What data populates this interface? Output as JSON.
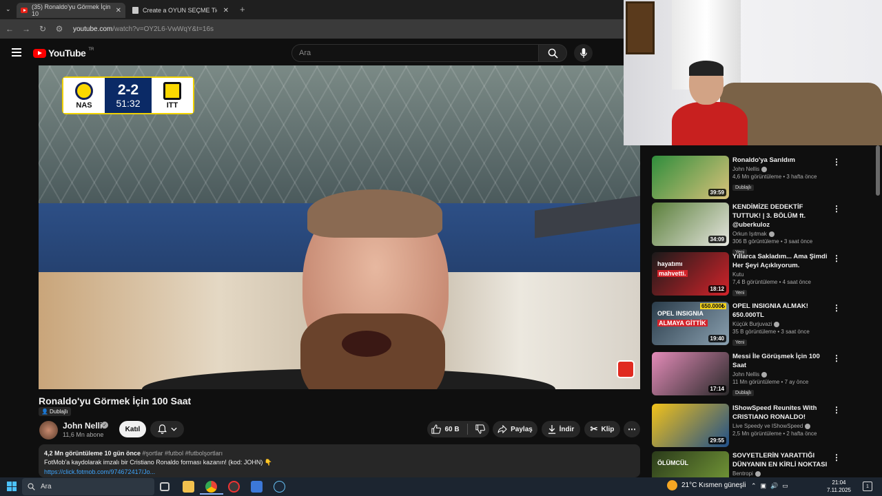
{
  "browser": {
    "tabs": [
      {
        "title": "(35) Ronaldo'yu Görmek İçin 10",
        "active": true
      },
      {
        "title": "Create a OYUN SEÇME Tier List",
        "active": false
      }
    ],
    "url_host": "youtube.com",
    "url_rest": "/watch?v=OY2L6-VwWqY&t=16s"
  },
  "youtube": {
    "logo_text": "YouTube",
    "region": "TR",
    "search_placeholder": "Ara"
  },
  "video": {
    "scoreboard": {
      "home": "NAS",
      "away": "ITT",
      "score": "2-2",
      "clock": "51:32"
    },
    "title": "Ronaldo'yu Görmek İçin 100 Saat",
    "dub_label": "Dublajlı"
  },
  "channel": {
    "name": "John Nellis",
    "subs": "11,6 Mn abone",
    "join_label": "Katıl"
  },
  "actions": {
    "likes": "60 B",
    "share": "Paylaş",
    "download": "İndir",
    "clip": "Klip"
  },
  "description": {
    "meta": "4,2 Mn görüntüleme  10 gün önce",
    "tags": "#şortlar #futbol #futbolşortları",
    "line1": "FotMob'a kaydolarak imzalı bir Cristiano Ronaldo forması kazanın! (kod: JOHN) 👇",
    "link": "https://click.fotmob.com/974672417/Jo..."
  },
  "sidebar": [
    {
      "title": "Ronaldo'ya Sarıldım",
      "channel": "John Nellis",
      "verified": true,
      "meta": "4,6 Mn görüntüleme • 3 hafta önce",
      "badge": "Dublajlı",
      "duration": "39:59",
      "c1": "#2f8d3c",
      "c2": "#d9c27a"
    },
    {
      "title": "KENDİMİZE DEDEKTİF TUTTUK! | 3. BÖLÜM ft. @uberkuloz",
      "channel": "Orkun Işıtmak",
      "verified": true,
      "meta": "306 B görüntüleme • 3 saat önce",
      "badge": "Yeni",
      "duration": "34:09",
      "c1": "#5a7f3a",
      "c2": "#e6e6e0"
    },
    {
      "title": "Yıllarca Sakladım... Ama Şimdi Her Şeyi Açıklıyorum.",
      "channel": "Kutu",
      "verified": false,
      "meta": "7,4 B görüntüleme • 4 saat önce",
      "badge": "Yeni",
      "duration": "18:12",
      "c1": "#1a1a1a",
      "c2": "#d3232a",
      "thumb_text1": "hayatımı",
      "thumb_text2": "mahvetti."
    },
    {
      "title": "OPEL INSIGNIA ALMAK! 650.000TL",
      "channel": "Küçük Burjuvazi",
      "verified": true,
      "meta": "35 B görüntüleme • 3 saat önce",
      "badge": "Yeni",
      "duration": "19:40",
      "c1": "#2a3c4a",
      "c2": "#8aa0b0",
      "thumb_text1": "OPEL INSIGNIA",
      "thumb_text2": "ALMAYA GİTTİK",
      "thumb_price": "650.000₺"
    },
    {
      "title": "Messi İle Görüşmek İçin 100 Saat",
      "channel": "John Nellis",
      "verified": true,
      "meta": "11 Mn görüntüleme • 7 ay önce",
      "badge": "Dublajlı",
      "duration": "17:14",
      "c1": "#e38bb8",
      "c2": "#2a2a2a"
    },
    {
      "title": "IShowSpeed Reunites With CRISTIANO RONALDO!",
      "channel": "Live Speedy ve IShowSpeed",
      "verified": true,
      "meta": "2,5 Mn görüntüleme • 2 hafta önce",
      "badge": "",
      "duration": "29:55",
      "c1": "#f2c21a",
      "c2": "#1f4f8a"
    },
    {
      "title": "SOVYETLERİN YARATTIĞI DÜNYANIN EN KİRLİ NOKTASI",
      "channel": "Bentropi",
      "verified": true,
      "meta": "",
      "badge": "",
      "duration": "",
      "c1": "#2a3a1a",
      "c2": "#7aa03a",
      "thumb_text1": "ÖLÜMCÜL"
    }
  ],
  "taskbar": {
    "search_label": "Ara",
    "weather": "21°C  Kısmen güneşli",
    "time": "21:04",
    "date": "7.11.2025"
  }
}
